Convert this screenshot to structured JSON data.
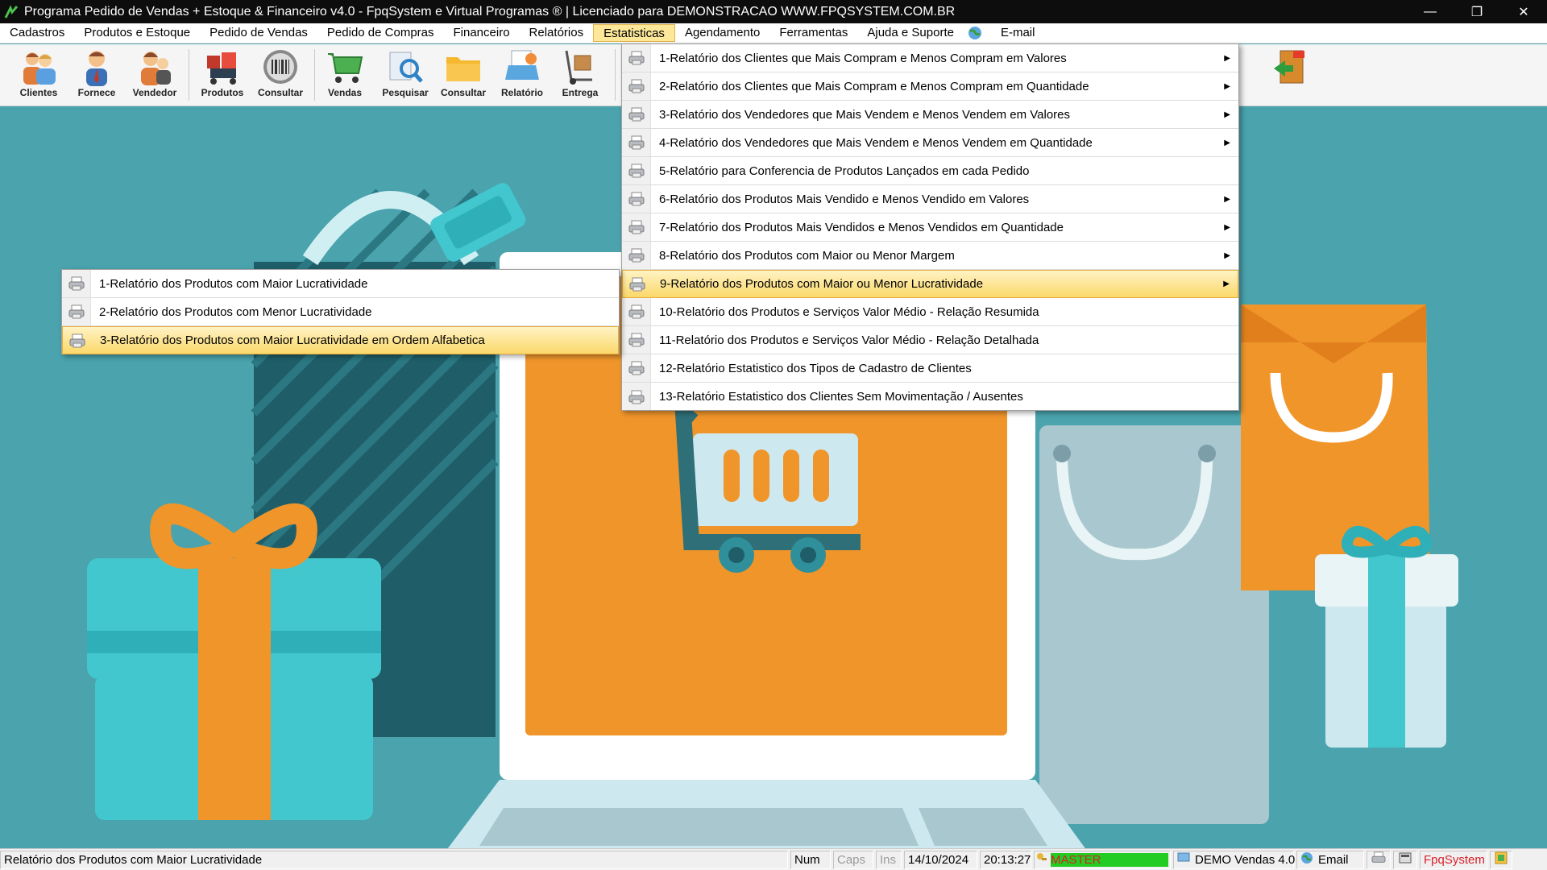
{
  "window": {
    "title": "Programa Pedido de Vendas + Estoque & Financeiro v4.0 - FpqSystem e Virtual Programas ® | Licenciado para  DEMONSTRACAO WWW.FPQSYSTEM.COM.BR",
    "minimize": "—",
    "restore": "❐",
    "close": "✕"
  },
  "menubar": [
    {
      "label": "Cadastros"
    },
    {
      "label": "Produtos e Estoque"
    },
    {
      "label": "Pedido de Vendas"
    },
    {
      "label": "Pedido de Compras"
    },
    {
      "label": "Financeiro"
    },
    {
      "label": "Relatórios"
    },
    {
      "label": "Estatisticas"
    },
    {
      "label": "Agendamento"
    },
    {
      "label": "Ferramentas"
    },
    {
      "label": "Ajuda e Suporte"
    },
    {
      "label": "E-mail"
    }
  ],
  "toolbar": [
    {
      "label": "Clientes",
      "icon": "clients-icon"
    },
    {
      "label": "Fornece",
      "icon": "supplier-icon"
    },
    {
      "label": "Vendedor",
      "icon": "seller-icon"
    },
    {
      "label": "Produtos",
      "icon": "products-icon"
    },
    {
      "label": "Consultar",
      "icon": "barcode-icon"
    },
    {
      "label": "Vendas",
      "icon": "cart-icon"
    },
    {
      "label": "Pesquisar",
      "icon": "search-icon"
    },
    {
      "label": "Consultar",
      "icon": "folder-icon"
    },
    {
      "label": "Relatório",
      "icon": "report-icon"
    },
    {
      "label": "Entrega",
      "icon": "handtruck-icon"
    }
  ],
  "stats_menu": [
    {
      "label": "1-Relatório dos Clientes que Mais Compram e Menos Compram em Valores",
      "arrow": "▶"
    },
    {
      "label": "2-Relatório dos Clientes que Mais Compram e Menos Compram em Quantidade",
      "arrow": "▶"
    },
    {
      "label": "3-Relatório dos Vendedores que Mais Vendem e Menos Vendem em Valores",
      "arrow": "▶"
    },
    {
      "label": "4-Relatório dos Vendedores que Mais Vendem e Menos Vendem em Quantidade",
      "arrow": "▶"
    },
    {
      "label": "5-Relatório para Conferencia de Produtos Lançados em cada Pedido",
      "arrow": ""
    },
    {
      "label": "6-Relatório dos Produtos Mais Vendido e Menos Vendido em Valores",
      "arrow": "▶"
    },
    {
      "label": "7-Relatório dos Produtos Mais Vendidos e Menos Vendidos em Quantidade",
      "arrow": "▶"
    },
    {
      "label": "8-Relatório dos Produtos com Maior ou Menor Margem",
      "arrow": "▶"
    },
    {
      "label": "9-Relatório dos Produtos com Maior ou Menor Lucratividade",
      "arrow": "▶"
    },
    {
      "label": "10-Relatório dos Produtos e Serviços Valor Médio - Relação Resumida",
      "arrow": ""
    },
    {
      "label": "11-Relatório dos Produtos e Serviços Valor Médio - Relação Detalhada",
      "arrow": ""
    },
    {
      "label": "12-Relatório Estatistico dos Tipos de Cadastro de Clientes",
      "arrow": ""
    },
    {
      "label": "13-Relatório Estatistico dos Clientes Sem Movimentação / Ausentes",
      "arrow": ""
    }
  ],
  "submenu": [
    {
      "label": "1-Relatório dos Produtos com Maior Lucratividade"
    },
    {
      "label": "2-Relatório dos Produtos com Menor Lucratividade"
    },
    {
      "label": "3-Relatório dos Produtos com Maior Lucratividade em Ordem Alfabetica"
    }
  ],
  "statusbar": {
    "hint": "Relatório dos Produtos com Maior Lucratividade",
    "num": "Num",
    "caps": "Caps",
    "ins": "Ins",
    "date": "14/10/2024",
    "time": "20:13:27",
    "user": "MASTER",
    "version": "DEMO Vendas 4.0",
    "email": "Email",
    "brand": "FpqSystem"
  },
  "colors": {
    "background": "#4aa3ad",
    "highlight": "#fbd86a",
    "orange": "#f0952a",
    "teal": "#43c7cf"
  }
}
